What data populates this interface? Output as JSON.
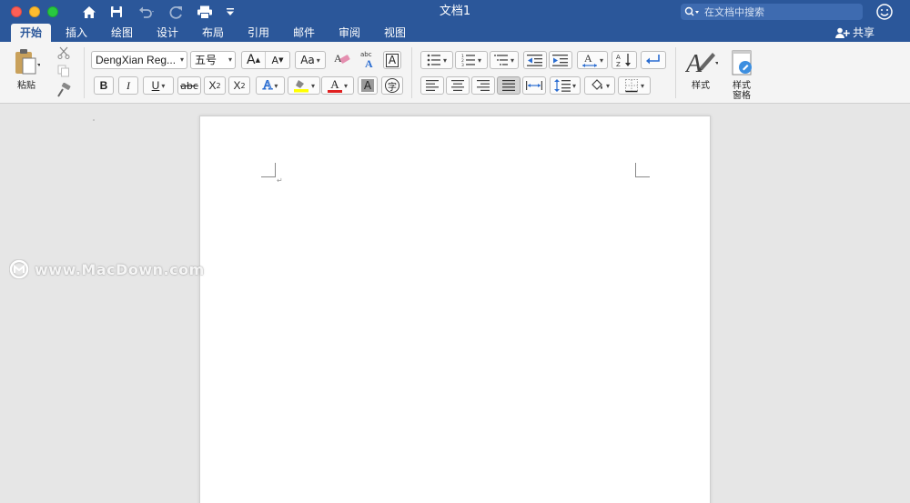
{
  "titlebar": {
    "doc_title": "文档1",
    "search_placeholder": "在文档中搜索"
  },
  "tabs": [
    {
      "label": "开始",
      "active": true
    },
    {
      "label": "插入"
    },
    {
      "label": "绘图"
    },
    {
      "label": "设计"
    },
    {
      "label": "布局"
    },
    {
      "label": "引用"
    },
    {
      "label": "邮件"
    },
    {
      "label": "审阅"
    },
    {
      "label": "视图"
    }
  ],
  "share_label": "共享",
  "ribbon": {
    "paste_label": "粘贴",
    "font_name": "DengXian Reg...",
    "font_size": "五号",
    "grow_font": "A",
    "shrink_font": "A",
    "change_case": "Aa",
    "bold": "B",
    "italic": "I",
    "underline": "U",
    "strikethrough": "abc",
    "subscript": "X",
    "superscript": "X",
    "text_effects": "A",
    "font_color": "A",
    "char_shading": "A",
    "enclosed_char": "字",
    "char_border": "A",
    "styles_label": "样式",
    "styles_pane_label_1": "样式",
    "styles_pane_label_2": "窗格"
  },
  "watermark_text": "www.MacDown.com",
  "colors": {
    "accent": "#2b579a",
    "highlight": "#ffff00",
    "font_color": "#e02020"
  }
}
